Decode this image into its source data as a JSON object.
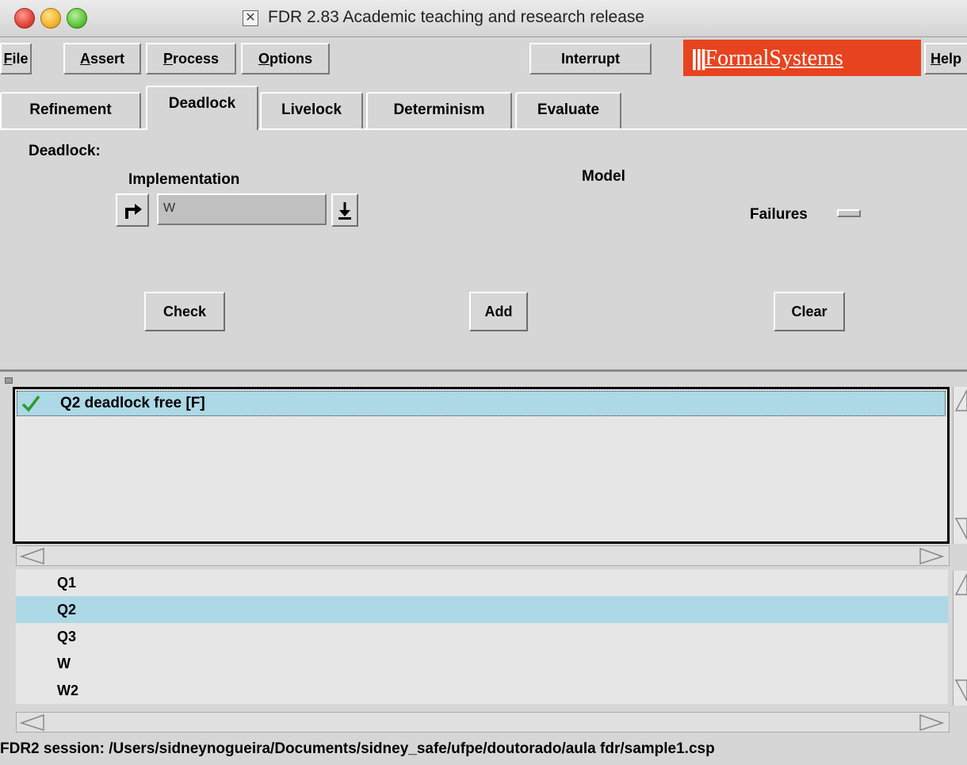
{
  "window": {
    "title": "FDR 2.83 Academic teaching and research release"
  },
  "menubar": {
    "file": {
      "accel": "F",
      "rest": "ile"
    },
    "assert": {
      "accel": "A",
      "rest": "ssert"
    },
    "process": {
      "accel": "P",
      "rest": "rocess"
    },
    "options": {
      "accel": "O",
      "rest": "ptions"
    },
    "interrupt": "Interrupt",
    "logo": {
      "bars": "|||",
      "text": "FormalSystems"
    },
    "help": {
      "accel": "H",
      "rest": "elp"
    }
  },
  "tabs": [
    {
      "label": "Refinement",
      "active": false
    },
    {
      "label": "Deadlock",
      "active": true
    },
    {
      "label": "Livelock",
      "active": false
    },
    {
      "label": "Determinism",
      "active": false
    },
    {
      "label": "Evaluate",
      "active": false
    }
  ],
  "deadlock_panel": {
    "heading": "Deadlock:",
    "implementation_label": "Implementation",
    "implementation_value": "W",
    "model_label": "Model",
    "failures_label": "Failures",
    "check_button": "Check",
    "add_button": "Add",
    "clear_button": "Clear"
  },
  "assertions": [
    {
      "text": "Q2 deadlock free [F]",
      "status": "passed",
      "selected": true
    }
  ],
  "processes": [
    {
      "name": "Q1",
      "selected": false
    },
    {
      "name": "Q2",
      "selected": true
    },
    {
      "name": "Q3",
      "selected": false
    },
    {
      "name": "W",
      "selected": false
    },
    {
      "name": "W2",
      "selected": false
    }
  ],
  "status_bar": {
    "text": "FDR2 session: /Users/sidneynogueira/Documents/sidney_safe/ufpe/doutorado/aula fdr/sample1.csp"
  },
  "colors": {
    "selection": "#add8e6",
    "logo_bg": "#e8431f",
    "check_green": "#2e9a2e"
  },
  "icons": {
    "follow_button": "corner-arrow-right-icon",
    "dropdown_button": "down-arrow-bar-icon",
    "assertion_status": "checkmark-icon"
  }
}
